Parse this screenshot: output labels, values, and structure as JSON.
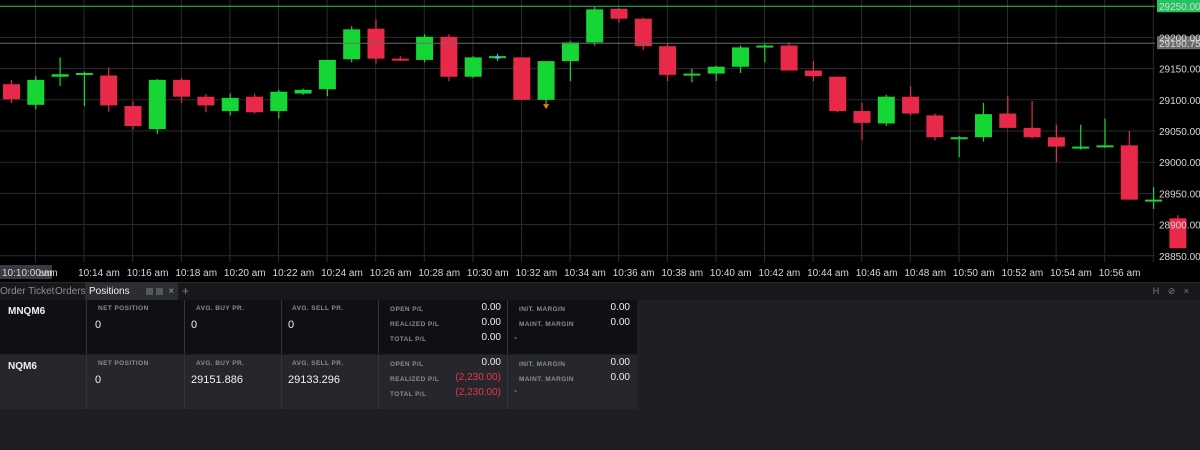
{
  "chart_data": {
    "type": "candlestick",
    "ylim": [
      28840,
      29260
    ],
    "y_ticks": [
      28850,
      28900,
      28950,
      29000,
      29050,
      29100,
      29150,
      29200
    ],
    "y_tick_labels": [
      "28850.00",
      "28900.00",
      "28950.00",
      "29000.00",
      "29050.00",
      "29100.00",
      "29150.00",
      "29200.00"
    ],
    "price_markers": [
      {
        "value": 29250,
        "label": "29250.00",
        "color": "#22c55e"
      },
      {
        "value": 29190.75,
        "label": "29190.75",
        "color": "#6b6b6b"
      }
    ],
    "x_labels": [
      {
        "label": "10:10:00 am",
        "slot": -0.6
      },
      {
        "label": "am",
        "slot": 1.4
      },
      {
        "label": "10:14 am",
        "slot": 3.6
      },
      {
        "label": "10:16 am",
        "slot": 5.6
      },
      {
        "label": "10:18 am",
        "slot": 7.6
      },
      {
        "label": "10:20 am",
        "slot": 9.6
      },
      {
        "label": "10:22 am",
        "slot": 11.6
      },
      {
        "label": "10:24 am",
        "slot": 13.6
      },
      {
        "label": "10:26 am",
        "slot": 15.6
      },
      {
        "label": "10:28 am",
        "slot": 17.6
      },
      {
        "label": "10:30 am",
        "slot": 19.6
      },
      {
        "label": "10:32 am",
        "slot": 21.6
      },
      {
        "label": "10:34 am",
        "slot": 23.6
      },
      {
        "label": "10:36 am",
        "slot": 25.6
      },
      {
        "label": "10:38 am",
        "slot": 27.6
      },
      {
        "label": "10:40 am",
        "slot": 29.6
      },
      {
        "label": "10:42 am",
        "slot": 31.6
      },
      {
        "label": "10:44 am",
        "slot": 33.6
      },
      {
        "label": "10:46 am",
        "slot": 35.6
      },
      {
        "label": "10:48 am",
        "slot": 37.6
      },
      {
        "label": "10:50 am",
        "slot": 39.6
      },
      {
        "label": "10:52 am",
        "slot": 41.6
      },
      {
        "label": "10:54 am",
        "slot": 43.6
      },
      {
        "label": "10:56 am",
        "slot": 45.6
      }
    ],
    "candles": [
      {
        "o": 29125,
        "h": 29132,
        "l": 29095,
        "c": 29101
      },
      {
        "o": 29092,
        "h": 29138,
        "l": 29085,
        "c": 29132
      },
      {
        "o": 29137,
        "h": 29168,
        "l": 29122,
        "c": 29141
      },
      {
        "o": 29143,
        "h": 29145,
        "l": 29090,
        "c": 29143
      },
      {
        "o": 29139,
        "h": 29152,
        "l": 29081,
        "c": 29091
      },
      {
        "o": 29090,
        "h": 29098,
        "l": 29052,
        "c": 29058
      },
      {
        "o": 29053,
        "h": 29133,
        "l": 29045,
        "c": 29132
      },
      {
        "o": 29132,
        "h": 29135,
        "l": 29095,
        "c": 29105
      },
      {
        "o": 29105,
        "h": 29109,
        "l": 29080,
        "c": 29091
      },
      {
        "o": 29082,
        "h": 29110,
        "l": 29075,
        "c": 29103
      },
      {
        "o": 29105,
        "h": 29110,
        "l": 29078,
        "c": 29080
      },
      {
        "o": 29082,
        "h": 29116,
        "l": 29070,
        "c": 29113
      },
      {
        "o": 29110,
        "h": 29118,
        "l": 29108,
        "c": 29116
      },
      {
        "o": 29117,
        "h": 29158,
        "l": 29106,
        "c": 29164
      },
      {
        "o": 29165,
        "h": 29218,
        "l": 29160,
        "c": 29213
      },
      {
        "o": 29214,
        "h": 29229,
        "l": 29158,
        "c": 29166
      },
      {
        "o": 29166,
        "h": 29170,
        "l": 29162,
        "c": 29163
      },
      {
        "o": 29164,
        "h": 29205,
        "l": 29160,
        "c": 29201
      },
      {
        "o": 29201,
        "h": 29205,
        "l": 29130,
        "c": 29137
      },
      {
        "o": 29137,
        "h": 29170,
        "l": 29135,
        "c": 29168
      },
      {
        "o": 29168,
        "h": 29174,
        "l": 29162,
        "c": 29170
      },
      {
        "o": 29168,
        "h": 29168,
        "l": 29103,
        "c": 29100
      },
      {
        "o": 29100,
        "h": 29155,
        "l": 29093,
        "c": 29162
      },
      {
        "o": 29162,
        "h": 29194,
        "l": 29130,
        "c": 29192
      },
      {
        "o": 29192,
        "h": 29249,
        "l": 29187,
        "c": 29245
      },
      {
        "o": 29246,
        "h": 29247,
        "l": 29224,
        "c": 29230
      },
      {
        "o": 29230,
        "h": 29232,
        "l": 29180,
        "c": 29186
      },
      {
        "o": 29186,
        "h": 29191,
        "l": 29130,
        "c": 29140
      },
      {
        "o": 29140,
        "h": 29150,
        "l": 29128,
        "c": 29142
      },
      {
        "o": 29142,
        "h": 29155,
        "l": 29130,
        "c": 29153
      },
      {
        "o": 29153,
        "h": 29187,
        "l": 29143,
        "c": 29184
      },
      {
        "o": 29185,
        "h": 29190,
        "l": 29160,
        "c": 29187
      },
      {
        "o": 29187,
        "h": 29192,
        "l": 29147,
        "c": 29147
      },
      {
        "o": 29147,
        "h": 29162,
        "l": 29130,
        "c": 29138
      },
      {
        "o": 29137,
        "h": 29137,
        "l": 29080,
        "c": 29082
      },
      {
        "o": 29082,
        "h": 29095,
        "l": 29035,
        "c": 29063
      },
      {
        "o": 29062,
        "h": 29108,
        "l": 29058,
        "c": 29105
      },
      {
        "o": 29105,
        "h": 29122,
        "l": 29075,
        "c": 29078
      },
      {
        "o": 29075,
        "h": 29078,
        "l": 29035,
        "c": 29040
      },
      {
        "o": 29038,
        "h": 29042,
        "l": 29008,
        "c": 29040
      },
      {
        "o": 29040,
        "h": 29095,
        "l": 29033,
        "c": 29077
      },
      {
        "o": 29078,
        "h": 29106,
        "l": 29055,
        "c": 29055
      },
      {
        "o": 29055,
        "h": 29098,
        "l": 29038,
        "c": 29040
      },
      {
        "o": 29040,
        "h": 29060,
        "l": 29000,
        "c": 29025
      },
      {
        "o": 29025,
        "h": 29060,
        "l": 29020,
        "c": 29025
      },
      {
        "o": 29025,
        "h": 29070,
        "l": 29023,
        "c": 29027
      },
      {
        "o": 29027,
        "h": 29050,
        "l": 28940,
        "c": 28940
      },
      {
        "o": 28940,
        "h": 28960,
        "l": 28925,
        "c": 28940
      },
      {
        "o": 28910,
        "h": 28915,
        "l": 28862,
        "c": 28862
      }
    ],
    "colors": {
      "up": "#16d635",
      "down": "#e8294a",
      "grid": "#2b2b2b",
      "background": "#000000"
    }
  },
  "tabs": {
    "order_ticket": "Order Ticket",
    "orders": "Orders",
    "positions": "Positions",
    "close": "×",
    "add": "+",
    "right_controls": "H ⊘ ×"
  },
  "positions": [
    {
      "symbol": "MNQM6",
      "net_position_hdr": "NET POSITION",
      "net_position": "0",
      "avg_buy_hdr": "AVG. BUY PR.",
      "avg_buy": "0",
      "avg_sell_hdr": "AVG. SELL PR.",
      "avg_sell": "0",
      "open_pl_lbl": "OPEN P/L",
      "open_pl": "0.00",
      "realized_pl_lbl": "REALIZED P/L",
      "realized_pl": "0.00",
      "total_pl_lbl": "TOTAL P/L",
      "total_pl": "0.00",
      "init_margin_lbl": "INIT. MARGIN",
      "init_margin": "0.00",
      "maint_margin_lbl": "MAINT. MARGIN",
      "maint_margin": "0.00",
      "dash": "-"
    },
    {
      "symbol": "NQM6",
      "net_position_hdr": "NET POSITION",
      "net_position": "0",
      "avg_buy_hdr": "AVG. BUY PR.",
      "avg_buy": "29151.886",
      "avg_sell_hdr": "AVG. SELL PR.",
      "avg_sell": "29133.296",
      "open_pl_lbl": "OPEN P/L",
      "open_pl": "0.00",
      "realized_pl_lbl": "REALIZED P/L",
      "realized_pl": "(2,230.00)",
      "total_pl_lbl": "TOTAL P/L",
      "total_pl": "(2,230.00)",
      "init_margin_lbl": "INIT. MARGIN",
      "init_margin": "0.00",
      "maint_margin_lbl": "MAINT. MARGIN",
      "maint_margin": "0.00",
      "dash": "-"
    }
  ]
}
